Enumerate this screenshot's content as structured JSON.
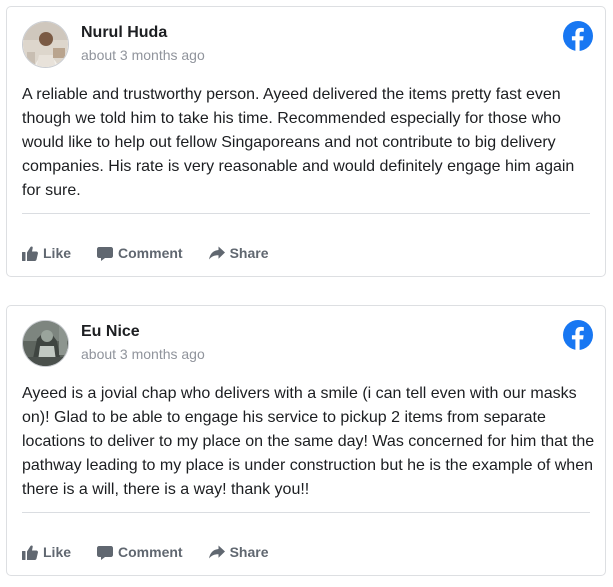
{
  "colors": {
    "facebook_blue": "#1877f2",
    "action_gray": "#606770",
    "timestamp_gray": "#90949c"
  },
  "reviews": [
    {
      "author": "Nurul Huda",
      "timestamp": "about 3 months ago",
      "source_icon": "facebook-icon",
      "text": "A reliable and trustworthy person. Ayeed delivered the items pretty fast even though we told him to take his time. Recommended especially for those who would like to help out fellow Singaporeans and not contribute to big delivery companies. His rate is very reasonable and would definitely engage him again for sure.",
      "actions": {
        "like": "Like",
        "comment": "Comment",
        "share": "Share"
      }
    },
    {
      "author": "Eu Nice",
      "timestamp": "about 3 months ago",
      "source_icon": "facebook-icon",
      "text": "Ayeed is a jovial chap who delivers with a smile (i can tell even with our masks on)! Glad to be able to engage his service to pickup 2 items from separate locations to deliver to my place on the same day! Was concerned for him that the pathway leading to my place is under construction but he is the example of when there is a will, there is a way! thank you!!",
      "actions": {
        "like": "Like",
        "comment": "Comment",
        "share": "Share"
      }
    }
  ]
}
